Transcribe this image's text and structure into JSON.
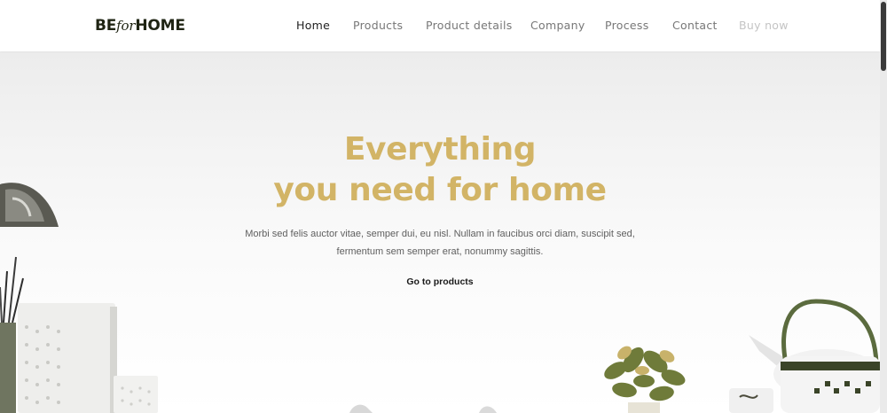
{
  "brand": {
    "logo_be": "BE",
    "logo_for": "for",
    "logo_home": "HOME"
  },
  "nav": {
    "items": [
      {
        "label": "Home"
      },
      {
        "label": "Products"
      },
      {
        "label": "Product details"
      },
      {
        "label": "Company"
      },
      {
        "label": "Process"
      },
      {
        "label": "Contact"
      }
    ],
    "cta_label": "Buy now"
  },
  "hero": {
    "title_line1": "Everything",
    "title_line2": "you need for home",
    "text_line1": "Morbi sed felis auctor vitae, semper dui, eu nisl. Nullam in faucibus orci diam, suscipit sed,",
    "text_line2": "fermentum sem semper erat, nonummy sagittis.",
    "cta_label": "Go to products"
  },
  "colors": {
    "accent": "#d2b466",
    "logo": "#1f2413",
    "nav_active": "#222222",
    "nav": "#777777",
    "nav_cta": "#c4c4c4",
    "teapot_handle": "#5b6b3e"
  }
}
